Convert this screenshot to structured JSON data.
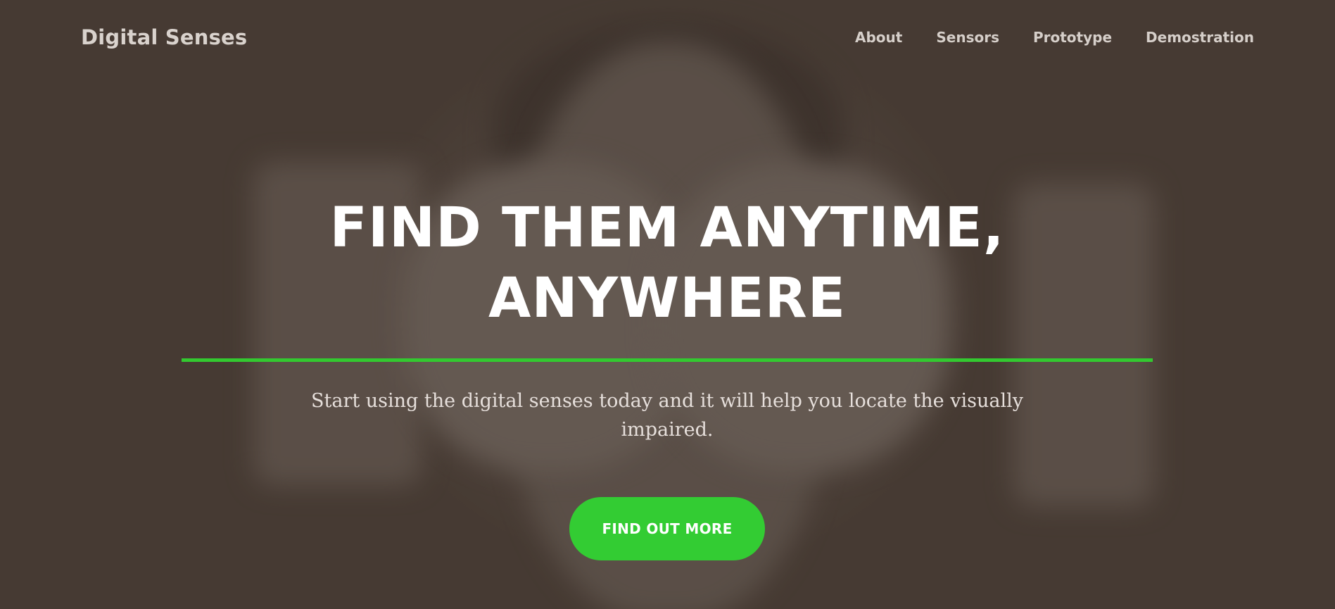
{
  "brand": {
    "name": "Digital Senses"
  },
  "nav": {
    "items": [
      {
        "label": "About"
      },
      {
        "label": "Sensors"
      },
      {
        "label": "Prototype"
      },
      {
        "label": "Demostration"
      }
    ]
  },
  "hero": {
    "headline": "FIND THEM ANYTIME, ANYWHERE",
    "subtext": "Start using the digital senses today and it will help you locate the visually impaired.",
    "cta_label": "FIND OUT MORE",
    "background_image": "blindfolded-face-hands-photo"
  },
  "colors": {
    "accent": "#33cc33",
    "background": "#4c4039",
    "nav_text": "#d6cfca",
    "headline": "#ffffff"
  }
}
